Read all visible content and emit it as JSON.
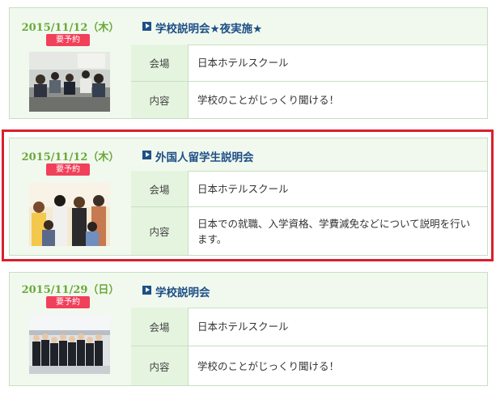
{
  "events": [
    {
      "date": "2015/11/12（木）",
      "badge": "要予約",
      "title": "学校説明会★夜実施★",
      "venue_label": "会場",
      "venue": "日本ホテルスクール",
      "content_label": "内容",
      "content": "学校のことがじっくり聞ける！"
    },
    {
      "date": "2015/11/12（木）",
      "badge": "要予約",
      "title": "外国人留学生説明会",
      "venue_label": "会場",
      "venue": "日本ホテルスクール",
      "content_label": "内容",
      "content": "日本での就職、入学資格、学費減免などについて説明を行います。"
    },
    {
      "date": "2015/11/29（日）",
      "badge": "要予約",
      "title": "学校説明会",
      "venue_label": "会場",
      "venue": "日本ホテルスクール",
      "content_label": "内容",
      "content": "学校のことがじっくり聞ける！"
    }
  ],
  "colors": {
    "date_green": "#6aa83b",
    "badge_red": "#f0405a",
    "title_blue": "#1d4f87",
    "highlight_red": "#d9202c",
    "panel_green": "#f1f9ee"
  },
  "icons": [
    "play-square-icon"
  ]
}
